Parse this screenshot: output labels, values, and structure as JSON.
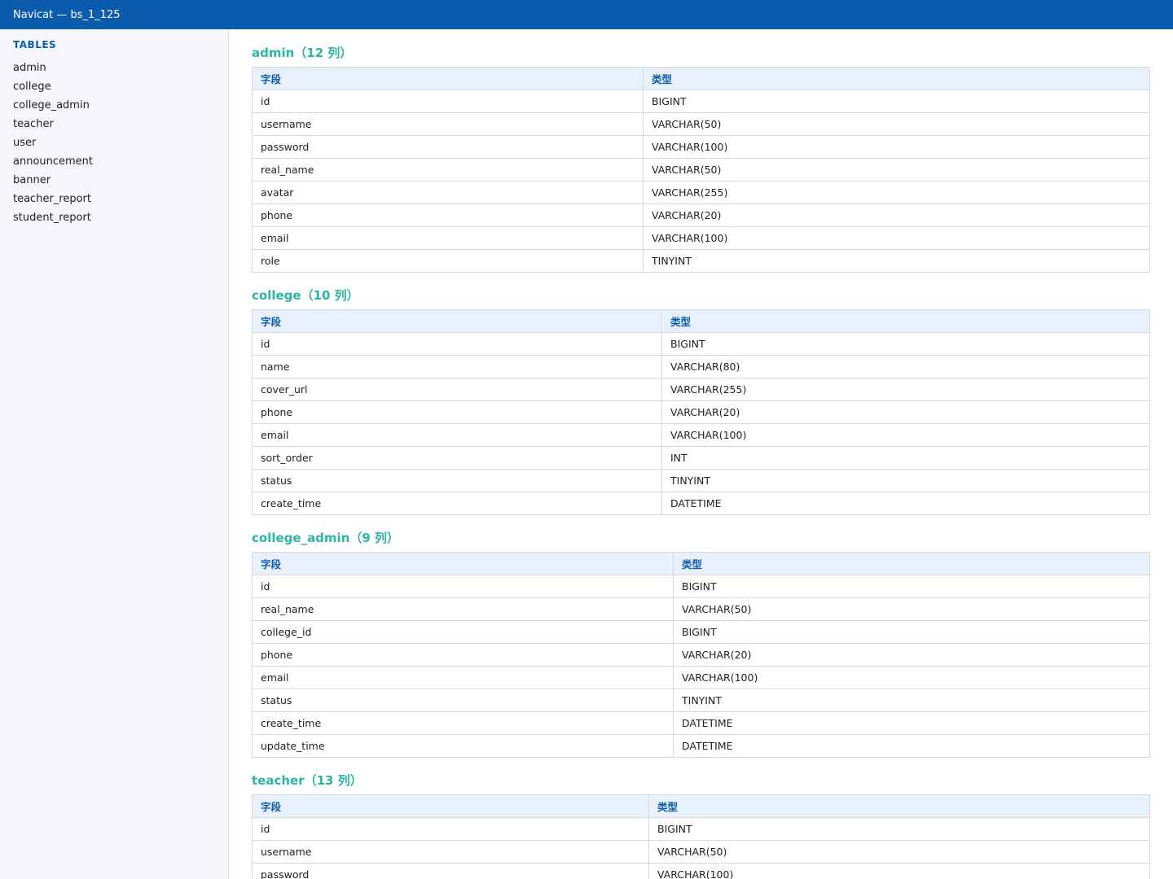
{
  "app": {
    "title": "Navicat — bs_1_125"
  },
  "sidebar": {
    "heading": "TABLES",
    "items": [
      "admin",
      "college",
      "college_admin",
      "teacher",
      "user",
      "announcement",
      "banner",
      "teacher_report",
      "student_report"
    ]
  },
  "colors": {
    "titlebar": "#0b5cad",
    "section_title": "#2cb5a0",
    "header_text": "#0b5cad",
    "header_bg": "#e8f1fb"
  },
  "tables": [
    {
      "title": "admin（12 列）",
      "headers": [
        "字段",
        "类型"
      ],
      "rows": [
        [
          "id",
          "BIGINT"
        ],
        [
          "username",
          "VARCHAR(50)"
        ],
        [
          "password",
          "VARCHAR(100)"
        ],
        [
          "real_name",
          "VARCHAR(50)"
        ],
        [
          "avatar",
          "VARCHAR(255)"
        ],
        [
          "phone",
          "VARCHAR(20)"
        ],
        [
          "email",
          "VARCHAR(100)"
        ],
        [
          "role",
          "TINYINT"
        ]
      ]
    },
    {
      "title": "college（10 列）",
      "headers": [
        "字段",
        "类型"
      ],
      "rows": [
        [
          "id",
          "BIGINT"
        ],
        [
          "name",
          "VARCHAR(80)"
        ],
        [
          "cover_url",
          "VARCHAR(255)"
        ],
        [
          "phone",
          "VARCHAR(20)"
        ],
        [
          "email",
          "VARCHAR(100)"
        ],
        [
          "sort_order",
          "INT"
        ],
        [
          "status",
          "TINYINT"
        ],
        [
          "create_time",
          "DATETIME"
        ]
      ]
    },
    {
      "title": "college_admin（9 列）",
      "headers": [
        "字段",
        "类型"
      ],
      "rows": [
        [
          "id",
          "BIGINT"
        ],
        [
          "real_name",
          "VARCHAR(50)"
        ],
        [
          "college_id",
          "BIGINT"
        ],
        [
          "phone",
          "VARCHAR(20)"
        ],
        [
          "email",
          "VARCHAR(100)"
        ],
        [
          "status",
          "TINYINT"
        ],
        [
          "create_time",
          "DATETIME"
        ],
        [
          "update_time",
          "DATETIME"
        ]
      ]
    },
    {
      "title": "teacher（13 列）",
      "headers": [
        "字段",
        "类型"
      ],
      "rows": [
        [
          "id",
          "BIGINT"
        ],
        [
          "username",
          "VARCHAR(50)"
        ],
        [
          "password",
          "VARCHAR(100)"
        ]
      ]
    }
  ]
}
